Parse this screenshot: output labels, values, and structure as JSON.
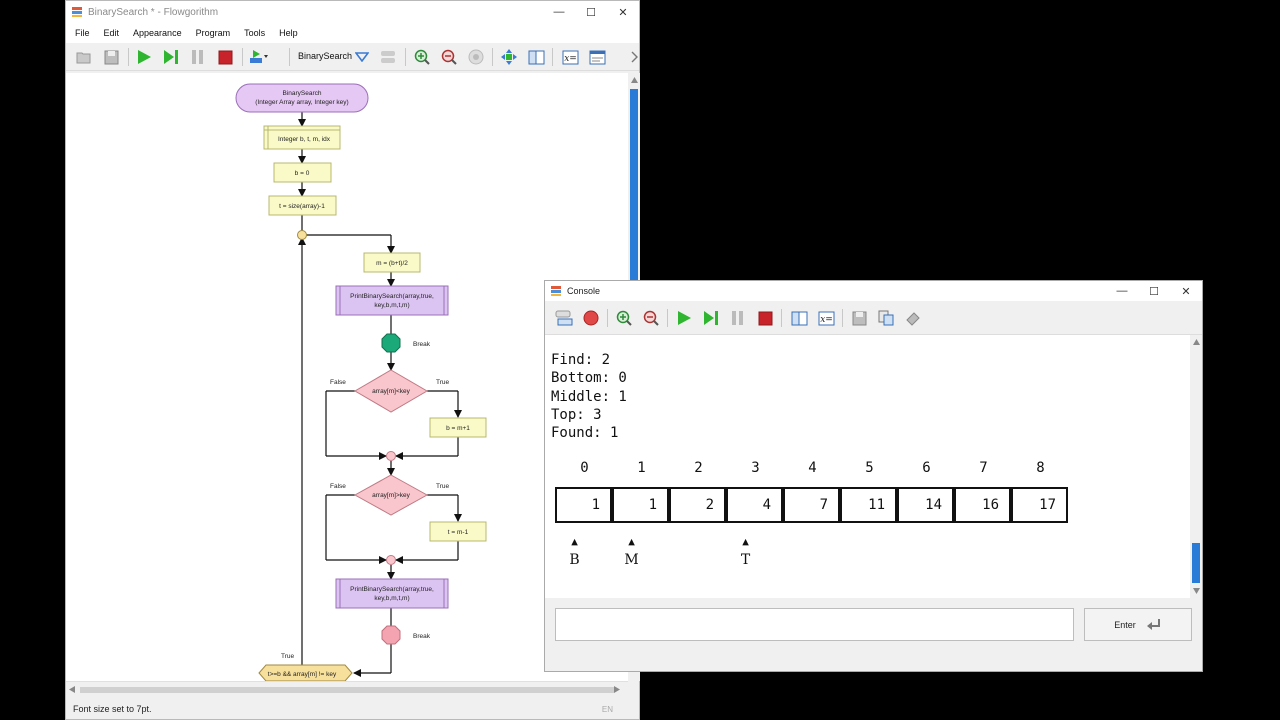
{
  "main_window": {
    "title": "BinarySearch * - Flowgorithm",
    "menu": [
      "File",
      "Edit",
      "Appearance",
      "Program",
      "Tools",
      "Help"
    ],
    "function_selector": "BinarySearch",
    "status": "Font size set to 7pt.",
    "lang": "EN"
  },
  "flowchart": {
    "start": {
      "line1": "BinarySearch",
      "line2": "(Integer Array array, Integer key)"
    },
    "declare": "Integer b, t, m, idx",
    "assign_b": "b = 0",
    "assign_t": "t = size(array)-1",
    "assign_m": "m = (b+t)/2",
    "call1": {
      "line1": "PrintBinarySearch(array,true,",
      "line2": "key,b,m,t,m)"
    },
    "break1": "Break",
    "if1": {
      "cond": "array[m]<key",
      "false": "False",
      "true": "True",
      "body": "b = m+1"
    },
    "if2": {
      "cond": "array[m]>key",
      "false": "False",
      "true": "True",
      "body": "t = m-1"
    },
    "call2": {
      "line1": "PrintBinarySearch(array,true,",
      "line2": "key,b,m,t,m)"
    },
    "break2": "Break",
    "loop": {
      "cond": "t>=b && array[m] != key",
      "true": "True"
    }
  },
  "console": {
    "title": "Console",
    "lines": [
      "Find: 2",
      "Bottom: 0",
      "Middle: 1",
      "Top: 3",
      "Found: 1"
    ],
    "indices": [
      "0",
      "1",
      "2",
      "3",
      "4",
      "5",
      "6",
      "7",
      "8"
    ],
    "values": [
      "1",
      "1",
      "2",
      "4",
      "7",
      "11",
      "14",
      "16",
      "17"
    ],
    "pointers": [
      {
        "label": "B",
        "index": 0
      },
      {
        "label": "M",
        "index": 1
      },
      {
        "label": "T",
        "index": 3
      }
    ],
    "input_value": "",
    "enter_label": "Enter"
  },
  "colors": {
    "terminal_fill": "#e6c8f5",
    "process_fill": "#fafac8",
    "decision_fill": "#f8c6cc",
    "call_fill": "#dcc4f2",
    "break_active": "#1ba97a",
    "break_inactive": "#f4a3b0",
    "loop_fill": "#f7df9c",
    "scroll_thumb": "#2a7ad8"
  }
}
